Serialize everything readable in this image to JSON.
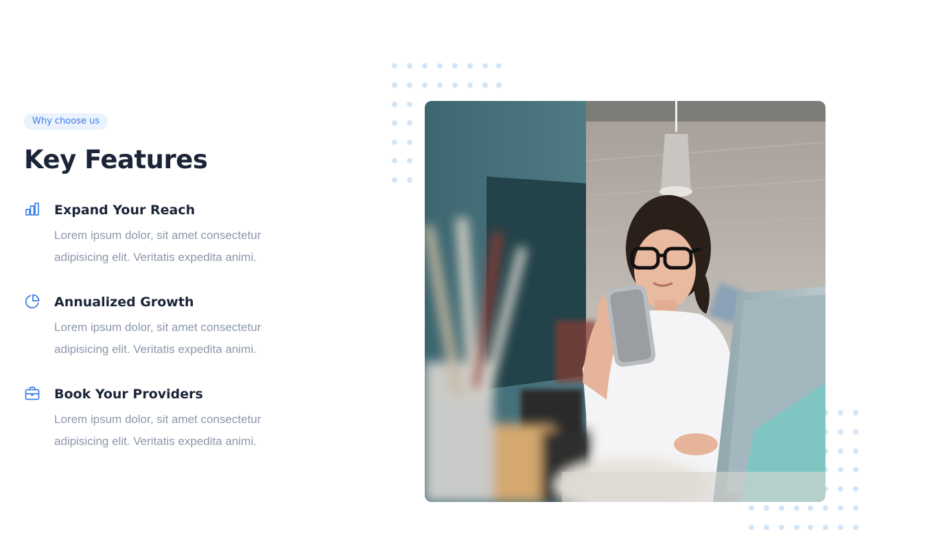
{
  "section": {
    "badge": "Why choose us",
    "title": "Key Features"
  },
  "features": [
    {
      "icon": "bar-chart-icon",
      "title": "Expand Your Reach",
      "text": "Lorem ipsum dolor, sit amet consectetur adipisicing elit. Veritatis expedita animi."
    },
    {
      "icon": "pie-chart-icon",
      "title": "Annualized Growth",
      "text": "Lorem ipsum dolor, sit amet consectetur adipisicing elit. Veritatis expedita animi."
    },
    {
      "icon": "briefcase-icon",
      "title": "Book Your Providers",
      "text": "Lorem ipsum dolor, sit amet consectetur adipisicing elit. Veritatis expedita animi."
    }
  ],
  "colors": {
    "accent": "#3b7de3",
    "badge_bg": "#eaf2fd",
    "heading": "#1b2538",
    "body_text": "#8c97ab",
    "dots": "#d4e6f6"
  }
}
